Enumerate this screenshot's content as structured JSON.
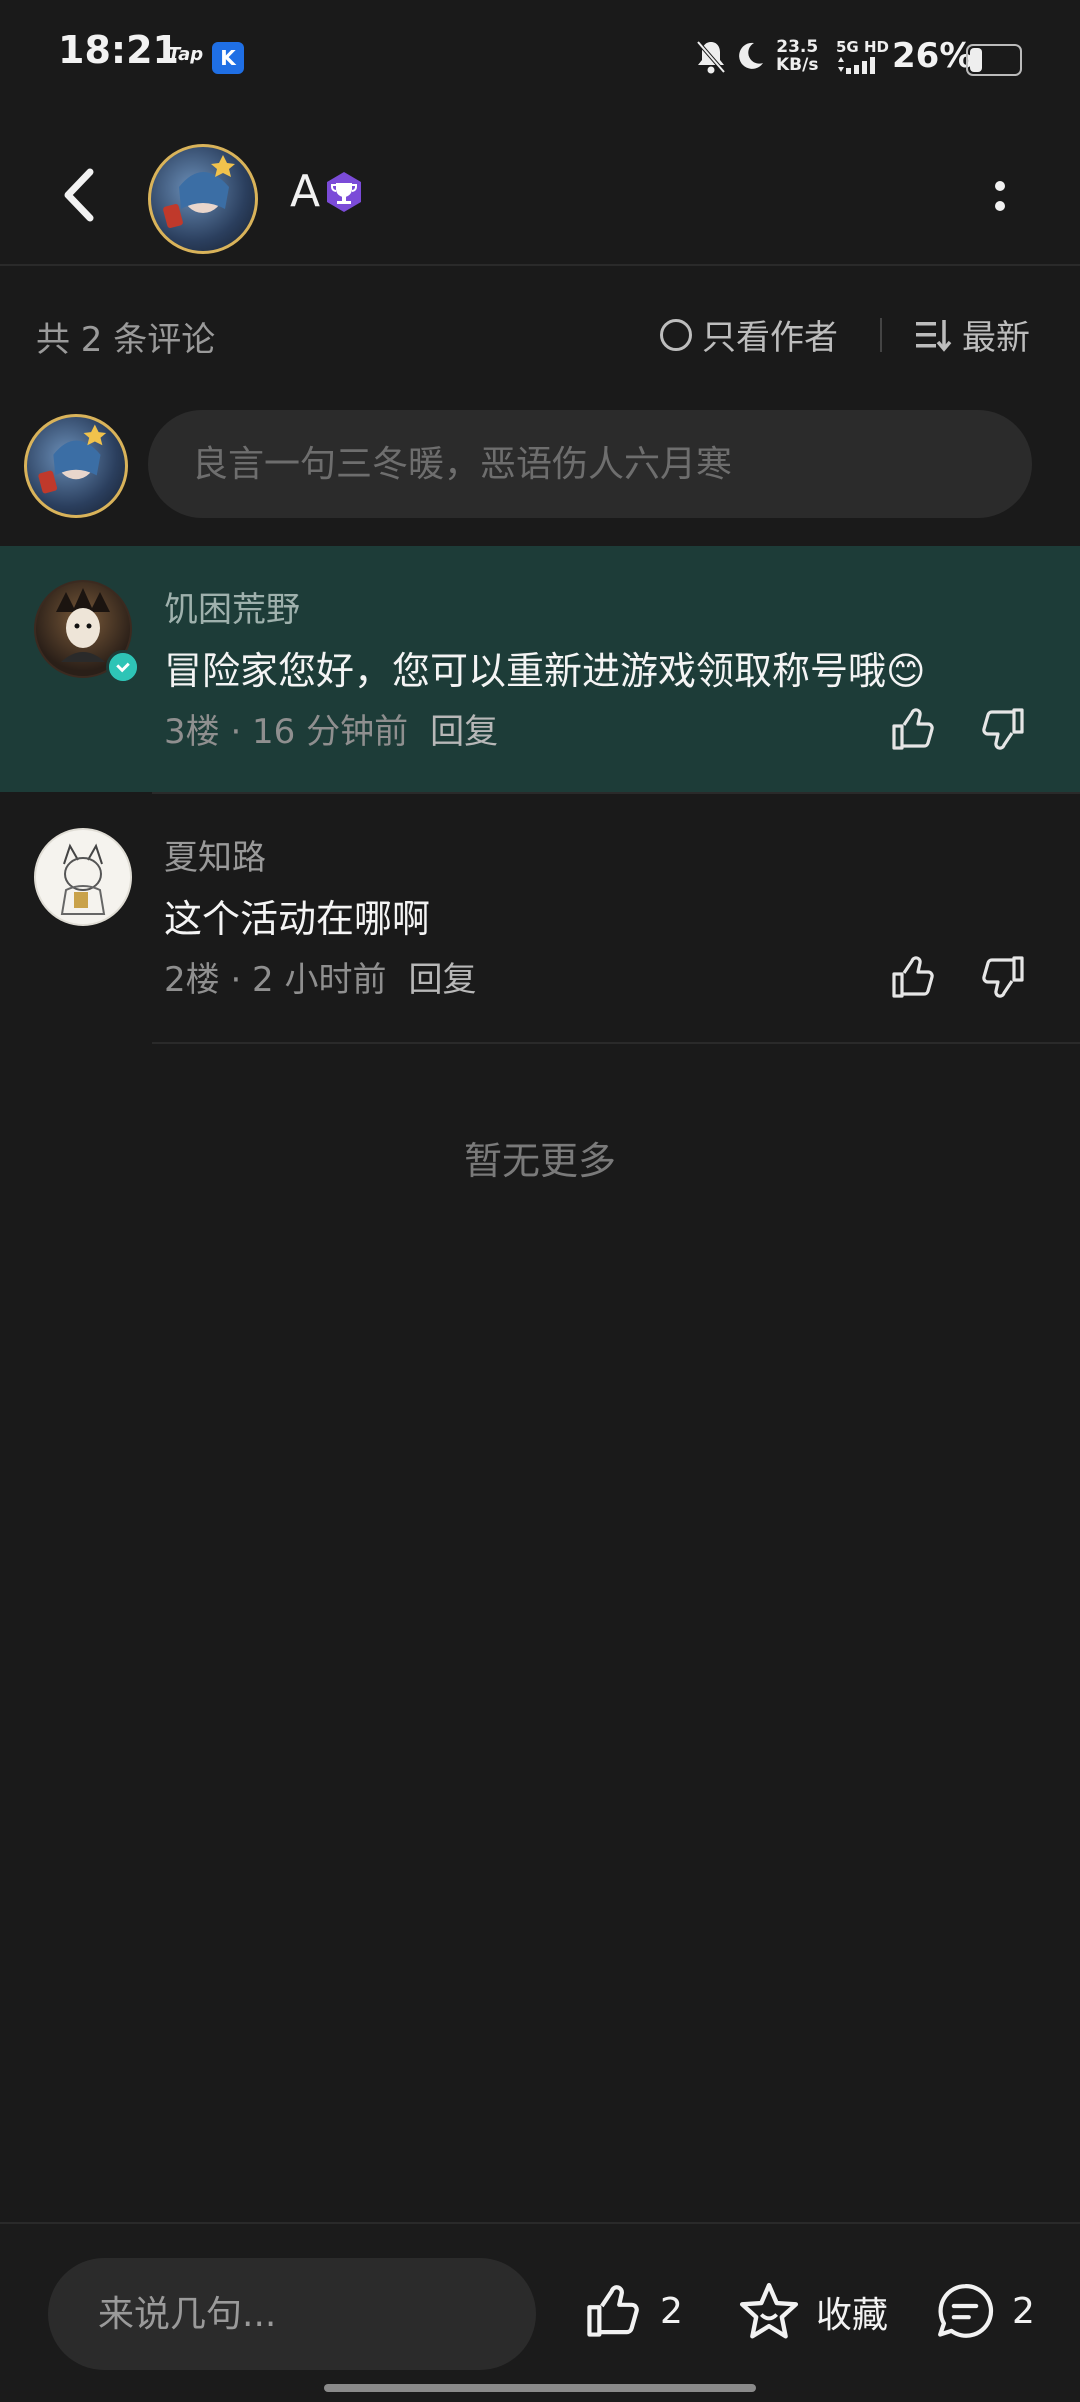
{
  "status_bar": {
    "time": "18:21",
    "app_tag": "Tap",
    "k_badge": "K",
    "net_speed_value": "23.5",
    "net_speed_unit": "KB/s",
    "signal": "5G HD",
    "battery_pct": "26%",
    "battery_level": 0.26
  },
  "header": {
    "author_name": "A",
    "back_icon": "chevron-left-icon",
    "more_icon": "more-vertical-icon"
  },
  "toolbar": {
    "comment_count": "共 2 条评论",
    "only_author": "只看作者",
    "sort": "最新"
  },
  "input": {
    "placeholder": "良言一句三冬暖，恶语伤人六月寒"
  },
  "comments": [
    {
      "user": "饥困荒野",
      "text": "冒险家您好，您可以重新进游戏领取称号哦😊",
      "floor_time": "3楼 · 16 分钟前",
      "reply": "回复",
      "highlighted": true,
      "verified": true
    },
    {
      "user": "夏知路",
      "text": "这个活动在哪啊",
      "floor_time": "2楼 · 2 小时前",
      "reply": "回复",
      "highlighted": false,
      "verified": false
    }
  ],
  "no_more": "暂无更多",
  "bottom_bar": {
    "placeholder": "来说几句...",
    "like_count": "2",
    "favorite_label": "收藏",
    "comment_count": "2"
  },
  "colors": {
    "background": "#1a1a1a",
    "highlight": "#1d3c38",
    "verified": "#2ec4b6",
    "badge_purple": "#7b4bd8"
  }
}
